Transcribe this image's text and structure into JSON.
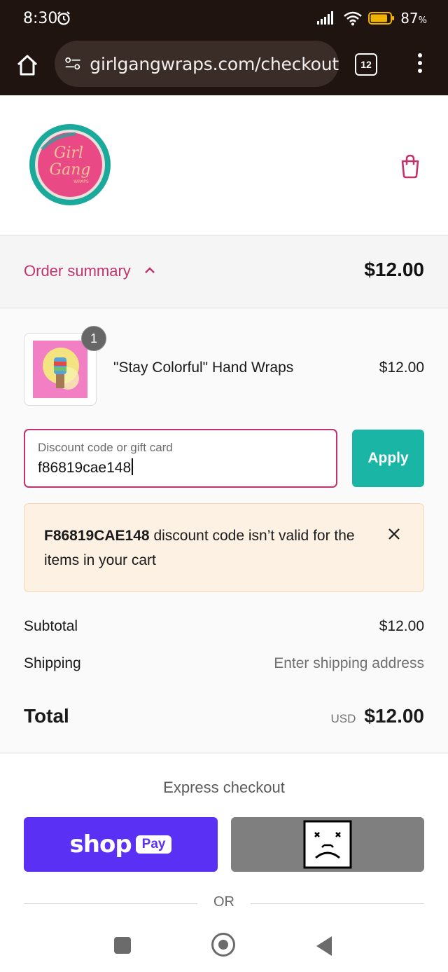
{
  "status_bar": {
    "time": "8:30",
    "battery_percent": "87",
    "battery_unit": "%",
    "battery_level": 0.87,
    "icons": [
      "alarm-icon",
      "signal-icon",
      "wifi-icon",
      "battery-icon"
    ]
  },
  "browser": {
    "url": "girlgangwraps.com/checkout",
    "tab_count": "12",
    "icons": [
      "home-icon",
      "site-settings-icon",
      "tabs-icon",
      "more-vert-icon"
    ]
  },
  "store": {
    "logo_icon": "girl-gang-wraps-logo",
    "logo_text": "Girl Gang Wraps",
    "cart_icon": "shopping-bag-icon",
    "colors": {
      "brand_pink": "#c1336e",
      "brand_teal": "#1bb5a6"
    }
  },
  "order_summary": {
    "label": "Order summary",
    "chevron_icon": "chevron-up-icon",
    "total": "$12.00"
  },
  "line_item": {
    "quantity": "1",
    "name": "\"Stay Colorful\" Hand Wraps",
    "price": "$12.00"
  },
  "discount": {
    "label": "Discount code or gift card",
    "value": "f86819cae148",
    "apply_label": "Apply"
  },
  "error": {
    "code": "F86819CAE148",
    "message": " discount code isn’t valid for the items in your cart",
    "close_icon": "close-icon",
    "background": "#fdf1e3"
  },
  "totals": {
    "subtotal_label": "Subtotal",
    "subtotal_value": "$12.00",
    "shipping_label": "Shipping",
    "shipping_value": "Enter shipping address",
    "total_label": "Total",
    "currency": "USD",
    "total_value": "$12.00"
  },
  "express": {
    "title": "Express checkout",
    "shop_word": "shop",
    "pay_word": "Pay",
    "shoppay_color": "#5a31f4",
    "broken_icon": "broken-image-icon",
    "or_label": "OR"
  },
  "nav": {
    "icons": [
      "recents-icon",
      "home-icon",
      "back-icon"
    ]
  }
}
